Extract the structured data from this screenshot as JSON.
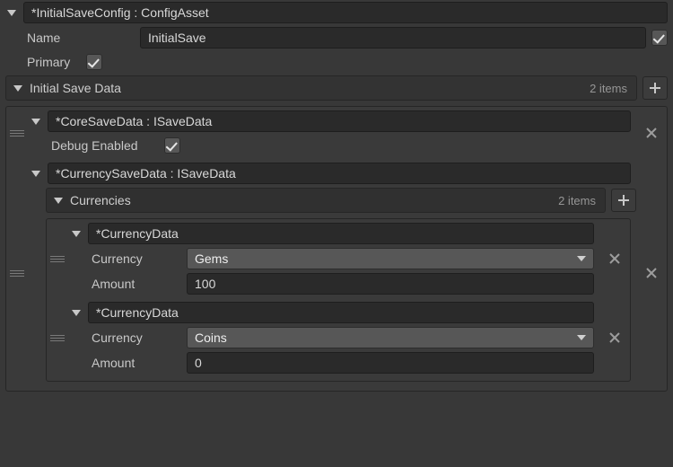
{
  "header": {
    "asset_title": "*InitialSaveConfig : ConfigAsset"
  },
  "fields": {
    "name_label": "Name",
    "name_value": "InitialSave",
    "primary_label": "Primary",
    "primary_checked": true
  },
  "initialSaveData": {
    "title": "Initial Save Data",
    "item_count_text": "2 items",
    "items": [
      {
        "title": "*CoreSaveData : ISaveData",
        "debug_label": "Debug Enabled",
        "debug_checked": true
      },
      {
        "title": "*CurrencySaveData : ISaveData",
        "currencies": {
          "title": "Currencies",
          "item_count_text": "2 items",
          "entries": [
            {
              "type_title": "*CurrencyData",
              "currency_label": "Currency",
              "currency_value": "Gems",
              "amount_label": "Amount",
              "amount_value": "100"
            },
            {
              "type_title": "*CurrencyData",
              "currency_label": "Currency",
              "currency_value": "Coins",
              "amount_label": "Amount",
              "amount_value": "0"
            }
          ]
        }
      }
    ]
  }
}
